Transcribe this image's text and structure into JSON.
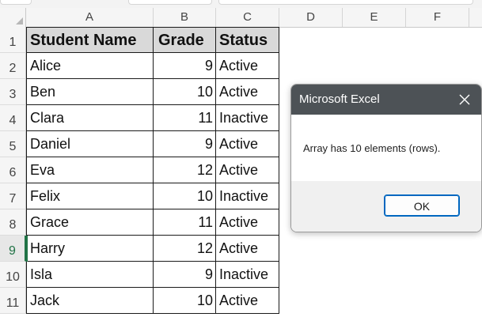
{
  "column_headers": [
    "A",
    "B",
    "C",
    "D",
    "E",
    "F"
  ],
  "row_headers": [
    "1",
    "2",
    "3",
    "4",
    "5",
    "6",
    "7",
    "8",
    "9",
    "10",
    "11"
  ],
  "active_row": "9",
  "table": {
    "headers": [
      "Student Name",
      "Grade",
      "Status"
    ],
    "rows": [
      [
        "Alice",
        "9",
        "Active"
      ],
      [
        "Ben",
        "10",
        "Active"
      ],
      [
        "Clara",
        "11",
        "Inactive"
      ],
      [
        "Daniel",
        "9",
        "Active"
      ],
      [
        "Eva",
        "12",
        "Active"
      ],
      [
        "Felix",
        "10",
        "Inactive"
      ],
      [
        "Grace",
        "11",
        "Active"
      ],
      [
        "Harry",
        "12",
        "Active"
      ],
      [
        "Isla",
        "9",
        "Inactive"
      ],
      [
        "Jack",
        "10",
        "Active"
      ]
    ]
  },
  "dialog": {
    "title": "Microsoft Excel",
    "message": "Array has 10 elements (rows).",
    "ok_label": "OK",
    "close_icon": "close-icon"
  },
  "colors": {
    "header_fill": "#d9d9d9",
    "dialog_title_bar": "#4d5256",
    "ok_button_border": "#0067c0",
    "active_row_accent": "#217346"
  }
}
